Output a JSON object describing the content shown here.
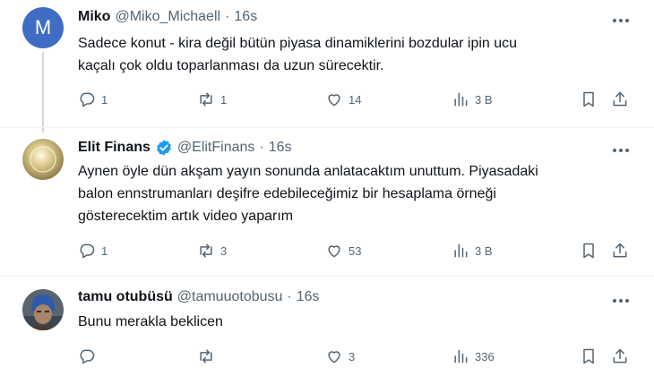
{
  "tweets": [
    {
      "avatar_letter": "M",
      "avatar_color": "#3f6dc3",
      "display_name": "Miko",
      "handle": "@Miko_Michaell",
      "separator": "·",
      "time": "16s",
      "lines": [
        "Sadece konut - kira değil bütün piyasa  dinamiklerini bozdular ipin ucu",
        "kaçalı çok oldu toparlanması da uzun sürecektir."
      ],
      "replies": "1",
      "retweets": "1",
      "likes": "14",
      "views": "3 B"
    },
    {
      "display_name": "Elit Finans",
      "verified": true,
      "handle": "@ElitFinans",
      "separator": "·",
      "time": "16s",
      "lines": [
        "Aynen öyle dün akşam yayın sonunda anlatacaktım unuttum. Piyasadaki",
        "balon ennstrumanları deşifre edebileceğimiz bir hesaplama örneği",
        "gösterecektim artık video yaparım"
      ],
      "replies": "1",
      "retweets": "3",
      "likes": "53",
      "views": "3 B"
    },
    {
      "display_name": "tamu otubüsü",
      "handle": "@tamuuotobusu",
      "separator": "·",
      "time": "16s",
      "lines": [
        "Bunu merakla beklicen"
      ],
      "replies": "",
      "retweets": "",
      "likes": "3",
      "views": "336"
    }
  ],
  "colors": {
    "verified_badge": "#1d9bf0",
    "secondary_text": "#536471",
    "thread_line": "#cfd9de"
  }
}
